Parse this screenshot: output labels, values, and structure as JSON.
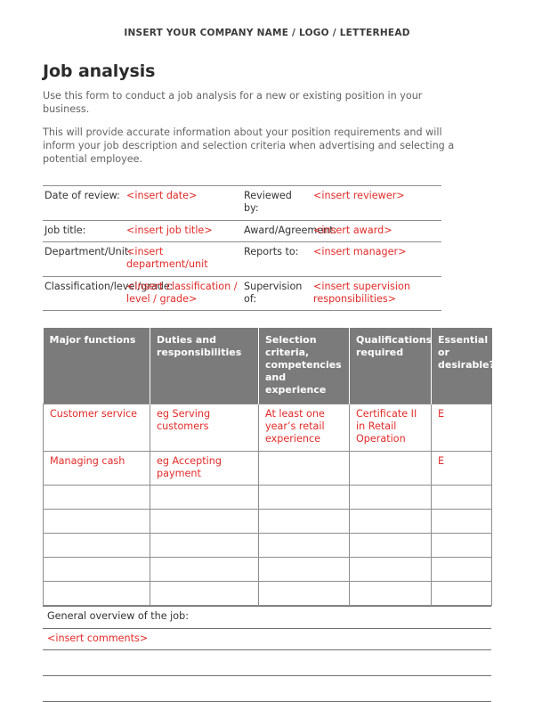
{
  "letterhead": "INSERT YOUR COMPANY NAME / LOGO / LETTERHEAD",
  "title": "Job analysis",
  "intro": {
    "paragraph1": "Use this form to conduct a job analysis for a new or existing position in your business.",
    "paragraph2": "This will provide accurate information about your position requirements and will inform your job description and selection criteria when advertising and selecting a potential employee."
  },
  "info_table": {
    "rows": [
      {
        "left_label": "Date of review:",
        "left_value": "<insert date>",
        "right_label": "Reviewed by:",
        "right_value": "<insert reviewer>"
      },
      {
        "left_label": "Job title:",
        "left_value": "<insert job title>",
        "right_label": "Award/Agreement:",
        "right_value": "<insert award>"
      },
      {
        "left_label": "Department/Unit:",
        "left_value": "<insert department/unit",
        "right_label": "Reports to:",
        "right_value": "<insert manager>"
      },
      {
        "left_label": "Classification/level/grade:",
        "left_value": "<insert classification / level / grade>",
        "right_label": "Supervision of:",
        "right_value": "<insert supervision responsibilities>"
      }
    ]
  },
  "main_table": {
    "headers": [
      "Major functions",
      "Duties and responsibilities",
      "Selection criteria, competencies and experience",
      "Qualifications required",
      "Essential or desirable?"
    ],
    "rows": [
      {
        "major_function": "Customer service",
        "duties": "eg Serving customers",
        "selection_criteria": "At least one year’s retail experience",
        "qualifications": "Certificate II in Retail Operation",
        "essential": "E"
      },
      {
        "major_function": "Managing cash",
        "duties": "eg Accepting payment",
        "selection_criteria": "",
        "qualifications": "",
        "essential": "E"
      },
      {
        "major_function": "",
        "duties": "",
        "selection_criteria": "",
        "qualifications": "",
        "essential": ""
      },
      {
        "major_function": "",
        "duties": "",
        "selection_criteria": "",
        "qualifications": "",
        "essential": ""
      },
      {
        "major_function": "",
        "duties": "",
        "selection_criteria": "",
        "qualifications": "",
        "essential": ""
      },
      {
        "major_function": "",
        "duties": "",
        "selection_criteria": "",
        "qualifications": "",
        "essential": ""
      },
      {
        "major_function": "",
        "duties": "",
        "selection_criteria": "",
        "qualifications": "",
        "essential": ""
      }
    ]
  },
  "overview": {
    "heading": "General overview of the job:",
    "value": "<insert comments>",
    "blank_lines": 2
  },
  "colors": {
    "placeholder_red": "#e32b29",
    "header_gray": "#7b7b7b",
    "rule_gray": "#8d8d8d",
    "body_text": "#636363"
  }
}
